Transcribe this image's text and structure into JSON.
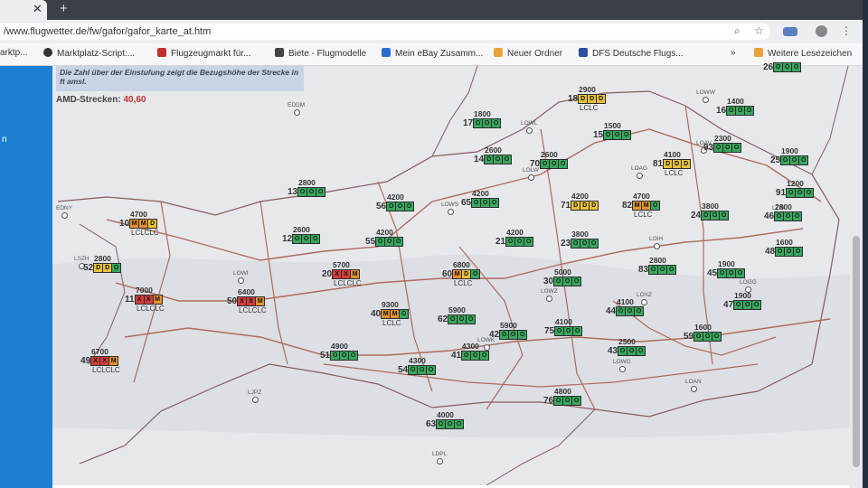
{
  "browser": {
    "tab_close": "✕",
    "new_tab": "+",
    "url": "/www.flugwetter.de/fw/gafor/gafor_karte_at.htm",
    "buttons": {
      "zoom": "⌕",
      "star": "☆",
      "more": "⋮"
    },
    "bookmarks": [
      {
        "label": "arktp...",
        "color": "#d87a2a"
      },
      {
        "label": "Marktplatz-Script:...",
        "color": "#333333"
      },
      {
        "label": "Flugzeugmarkt für...",
        "color": "#c43030"
      },
      {
        "label": "Biete - Flugmodelle",
        "color": "#444444"
      },
      {
        "label": "Mein eBay Zusamm...",
        "color": "#2a6fd0"
      },
      {
        "label": "Neuer Ordner",
        "color": "#e8a43a"
      },
      {
        "label": "DFS Deutsche Flugs...",
        "color": "#2a4fa0"
      },
      {
        "label": "»",
        "color": ""
      },
      {
        "label": "Weitere Lesezeichen",
        "color": "#e8a43a"
      }
    ]
  },
  "left_panel": {
    "text": "n"
  },
  "map": {
    "note": "Die Zahl über der Einstufung zeigt die Bezugshöhe der Strecke in ft amsl.",
    "amd_label": "AMD-Strecken:",
    "amd_value": "40,60",
    "colors": {
      "O": "#3aa660",
      "D": "#eac33a",
      "M": "#e2932e",
      "X": "#d43c3c"
    },
    "places": [
      "EDDM",
      "LOWL",
      "LOWW",
      "LOWS",
      "LOWI",
      "LOWK",
      "LOWG",
      "LOAV",
      "LOAG",
      "LOLW",
      "EDNY",
      "LSZH",
      "LOIH",
      "LOWZ",
      "LOXZ",
      "LJPZ",
      "LDPL",
      "LZIB",
      "LOAN",
      "LOGG"
    ],
    "routes": [
      {
        "id": "26",
        "alt": "",
        "codes": [
          "O",
          "O",
          "O"
        ],
        "lclc": ""
      },
      {
        "id": "18",
        "alt": "2900",
        "codes": [
          "D",
          "D",
          "D"
        ],
        "lclc": "LCLC"
      },
      {
        "id": "16",
        "alt": "1400",
        "codes": [
          "O",
          "O",
          "O"
        ],
        "lclc": ""
      },
      {
        "id": "17",
        "alt": "1800",
        "codes": [
          "O",
          "O",
          "O"
        ],
        "lclc": ""
      },
      {
        "id": "15",
        "alt": "1500",
        "codes": [
          "O",
          "O",
          "O"
        ],
        "lclc": ""
      },
      {
        "id": "93",
        "alt": "2300",
        "codes": [
          "O",
          "O",
          "O"
        ],
        "lclc": ""
      },
      {
        "id": "25",
        "alt": "1900",
        "codes": [
          "O",
          "O",
          "O"
        ],
        "lclc": ""
      },
      {
        "id": "14",
        "alt": "2600",
        "codes": [
          "O",
          "O",
          "O"
        ],
        "lclc": ""
      },
      {
        "id": "70",
        "alt": "2600",
        "codes": [
          "O",
          "O",
          "O"
        ],
        "lclc": ""
      },
      {
        "id": "81",
        "alt": "4100",
        "codes": [
          "D",
          "D",
          "D"
        ],
        "lclc": "LCLC"
      },
      {
        "id": "13",
        "alt": "2800",
        "codes": [
          "O",
          "O",
          "O"
        ],
        "lclc": ""
      },
      {
        "id": "91",
        "alt": "1200",
        "codes": [
          "O",
          "O",
          "O"
        ],
        "lclc": ""
      },
      {
        "id": "56",
        "alt": "4200",
        "codes": [
          "O",
          "O",
          "O"
        ],
        "lclc": ""
      },
      {
        "id": "65",
        "alt": "4200",
        "codes": [
          "O",
          "O",
          "O"
        ],
        "lclc": ""
      },
      {
        "id": "71",
        "alt": "4200",
        "codes": [
          "D",
          "D",
          "D"
        ],
        "lclc": ""
      },
      {
        "id": "82",
        "alt": "4700",
        "codes": [
          "M",
          "M",
          "O"
        ],
        "lclc": "LCLC"
      },
      {
        "id": "24",
        "alt": "3800",
        "codes": [
          "O",
          "O",
          "O"
        ],
        "lclc": ""
      },
      {
        "id": "46",
        "alt": "2800",
        "codes": [
          "O",
          "O",
          "O"
        ],
        "lclc": ""
      },
      {
        "id": "10",
        "alt": "4700",
        "codes": [
          "M",
          "M",
          "D"
        ],
        "lclc": "LCLCLC"
      },
      {
        "id": "12",
        "alt": "2600",
        "codes": [
          "O",
          "O",
          "O"
        ],
        "lclc": ""
      },
      {
        "id": "55",
        "alt": "4200",
        "codes": [
          "O",
          "O",
          "O"
        ],
        "lclc": ""
      },
      {
        "id": "21",
        "alt": "4200",
        "codes": [
          "O",
          "O",
          "O"
        ],
        "lclc": ""
      },
      {
        "id": "23",
        "alt": "3800",
        "codes": [
          "O",
          "O",
          "O"
        ],
        "lclc": ""
      },
      {
        "id": "48",
        "alt": "1600",
        "codes": [
          "O",
          "O",
          "O"
        ],
        "lclc": ""
      },
      {
        "id": "52",
        "alt": "2800",
        "codes": [
          "D",
          "D",
          "O"
        ],
        "lclc": ""
      },
      {
        "id": "20",
        "alt": "5700",
        "codes": [
          "X",
          "X",
          "M"
        ],
        "lclc": "LCLCLC"
      },
      {
        "id": "60",
        "alt": "6800",
        "codes": [
          "M",
          "D",
          "O"
        ],
        "lclc": "LCLC"
      },
      {
        "id": "83",
        "alt": "2800",
        "codes": [
          "O",
          "O",
          "O"
        ],
        "lclc": ""
      },
      {
        "id": "45",
        "alt": "1900",
        "codes": [
          "O",
          "O",
          "O"
        ],
        "lclc": ""
      },
      {
        "id": "30",
        "alt": "5000",
        "codes": [
          "O",
          "O",
          "O"
        ],
        "lclc": ""
      },
      {
        "id": "11",
        "alt": "7000",
        "codes": [
          "X",
          "X",
          "M"
        ],
        "lclc": "LCLCLC"
      },
      {
        "id": "50",
        "alt": "6400",
        "codes": [
          "X",
          "X",
          "M"
        ],
        "lclc": "LCLCLC"
      },
      {
        "id": "47",
        "alt": "1900",
        "codes": [
          "O",
          "O",
          "O"
        ],
        "lclc": ""
      },
      {
        "id": "40",
        "alt": "9300",
        "codes": [
          "M",
          "M",
          "O"
        ],
        "lclc": "LCLC"
      },
      {
        "id": "62",
        "alt": "5900",
        "codes": [
          "O",
          "O",
          "O"
        ],
        "lclc": ""
      },
      {
        "id": "44",
        "alt": "4100",
        "codes": [
          "O",
          "O",
          "O"
        ],
        "lclc": ""
      },
      {
        "id": "42",
        "alt": "5900",
        "codes": [
          "O",
          "O",
          "O"
        ],
        "lclc": ""
      },
      {
        "id": "75",
        "alt": "4100",
        "codes": [
          "O",
          "O",
          "O"
        ],
        "lclc": ""
      },
      {
        "id": "59",
        "alt": "1600",
        "codes": [
          "O",
          "O",
          "O"
        ],
        "lclc": ""
      },
      {
        "id": "51",
        "alt": "4900",
        "codes": [
          "O",
          "O",
          "O"
        ],
        "lclc": ""
      },
      {
        "id": "41",
        "alt": "4300",
        "codes": [
          "O",
          "O",
          "O"
        ],
        "lclc": ""
      },
      {
        "id": "43",
        "alt": "2500",
        "codes": [
          "O",
          "O",
          "O"
        ],
        "lclc": ""
      },
      {
        "id": "49",
        "alt": "6700",
        "codes": [
          "X",
          "X",
          "M"
        ],
        "lclc": "LCLCLC"
      },
      {
        "id": "54",
        "alt": "4300",
        "codes": [
          "O",
          "O",
          "O"
        ],
        "lclc": ""
      },
      {
        "id": "76",
        "alt": "4800",
        "codes": [
          "O",
          "O",
          "O"
        ],
        "lclc": ""
      },
      {
        "id": "63",
        "alt": "4000",
        "codes": [
          "O",
          "O",
          "O"
        ],
        "lclc": ""
      }
    ]
  }
}
